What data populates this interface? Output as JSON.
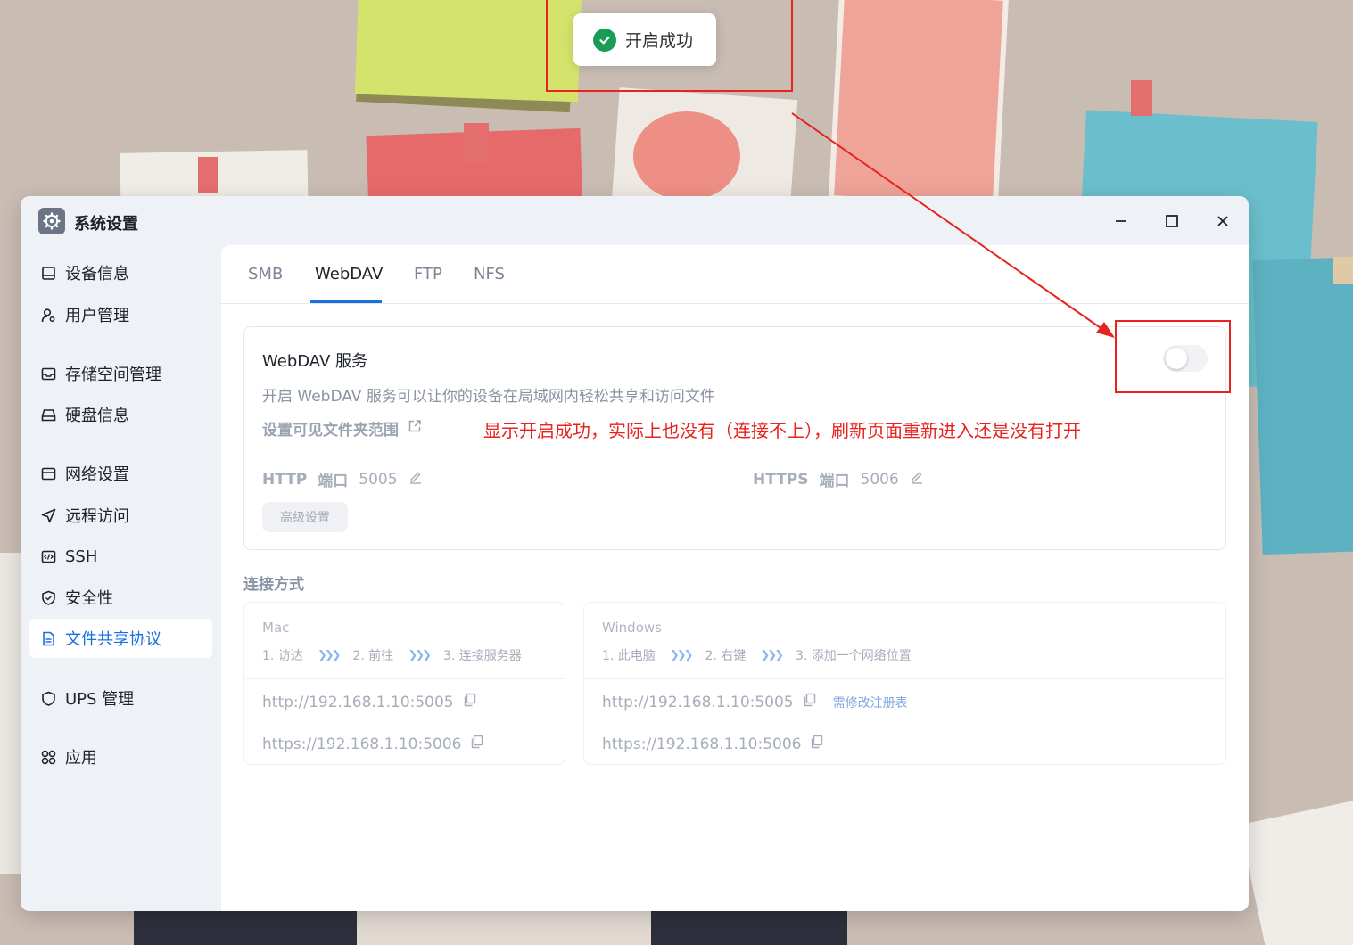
{
  "toast": {
    "text": "开启成功",
    "icon": "check-circle-icon",
    "color": "#1a9c57"
  },
  "window": {
    "title": "系统设置",
    "app_icon": "gear-icon",
    "controls": [
      "minimize-icon",
      "maximize-icon",
      "close-icon"
    ]
  },
  "sidebar": {
    "items": [
      {
        "label": "设备信息",
        "icon": "device-icon"
      },
      {
        "label": "用户管理",
        "icon": "user-gear-icon"
      },
      {
        "label": "存储空间管理",
        "icon": "inbox-icon"
      },
      {
        "label": "硬盘信息",
        "icon": "disk-icon"
      },
      {
        "label": "网络设置",
        "icon": "network-icon"
      },
      {
        "label": "远程访问",
        "icon": "send-icon"
      },
      {
        "label": "SSH",
        "icon": "code-icon"
      },
      {
        "label": "安全性",
        "icon": "shield-check-icon"
      },
      {
        "label": "文件共享协议",
        "icon": "document-icon",
        "active": true
      },
      {
        "label": "UPS 管理",
        "icon": "shield-icon"
      },
      {
        "label": "应用",
        "icon": "apps-icon"
      }
    ]
  },
  "tabs": {
    "items": [
      "SMB",
      "WebDAV",
      "FTP",
      "NFS"
    ],
    "active": "WebDAV"
  },
  "service": {
    "title": "WebDAV 服务",
    "description": "开启 WebDAV 服务可以让你的设备在局域网内轻松共享和访问文件",
    "scope_link": "设置可见文件夹范围",
    "enabled": false,
    "http_label": "HTTP",
    "http_unit": "端口",
    "http_port": "5005",
    "https_label": "HTTPS",
    "https_unit": "端口",
    "https_port": "5006",
    "advanced_button": "高级设置"
  },
  "annotation_text": "显示开启成功，实际上也没有（连接不上），刷新页面重新进入还是没有打开",
  "connection": {
    "title": "连接方式",
    "mac": {
      "os": "Mac",
      "steps": [
        "1. 访达",
        "2. 前往",
        "3. 连接服务器"
      ],
      "urls": [
        "http://192.168.1.10:5005",
        "https://192.168.1.10:5006"
      ]
    },
    "windows": {
      "os": "Windows",
      "steps": [
        "1. 此电脑",
        "2. 右键",
        "3. 添加一个网络位置"
      ],
      "urls": [
        "http://192.168.1.10:5005",
        "https://192.168.1.10:5006"
      ],
      "registry_link": "需修改注册表"
    }
  },
  "colors": {
    "accent": "#1a6fe0",
    "annotation_red": "#e8231f",
    "success": "#1a9c57"
  }
}
